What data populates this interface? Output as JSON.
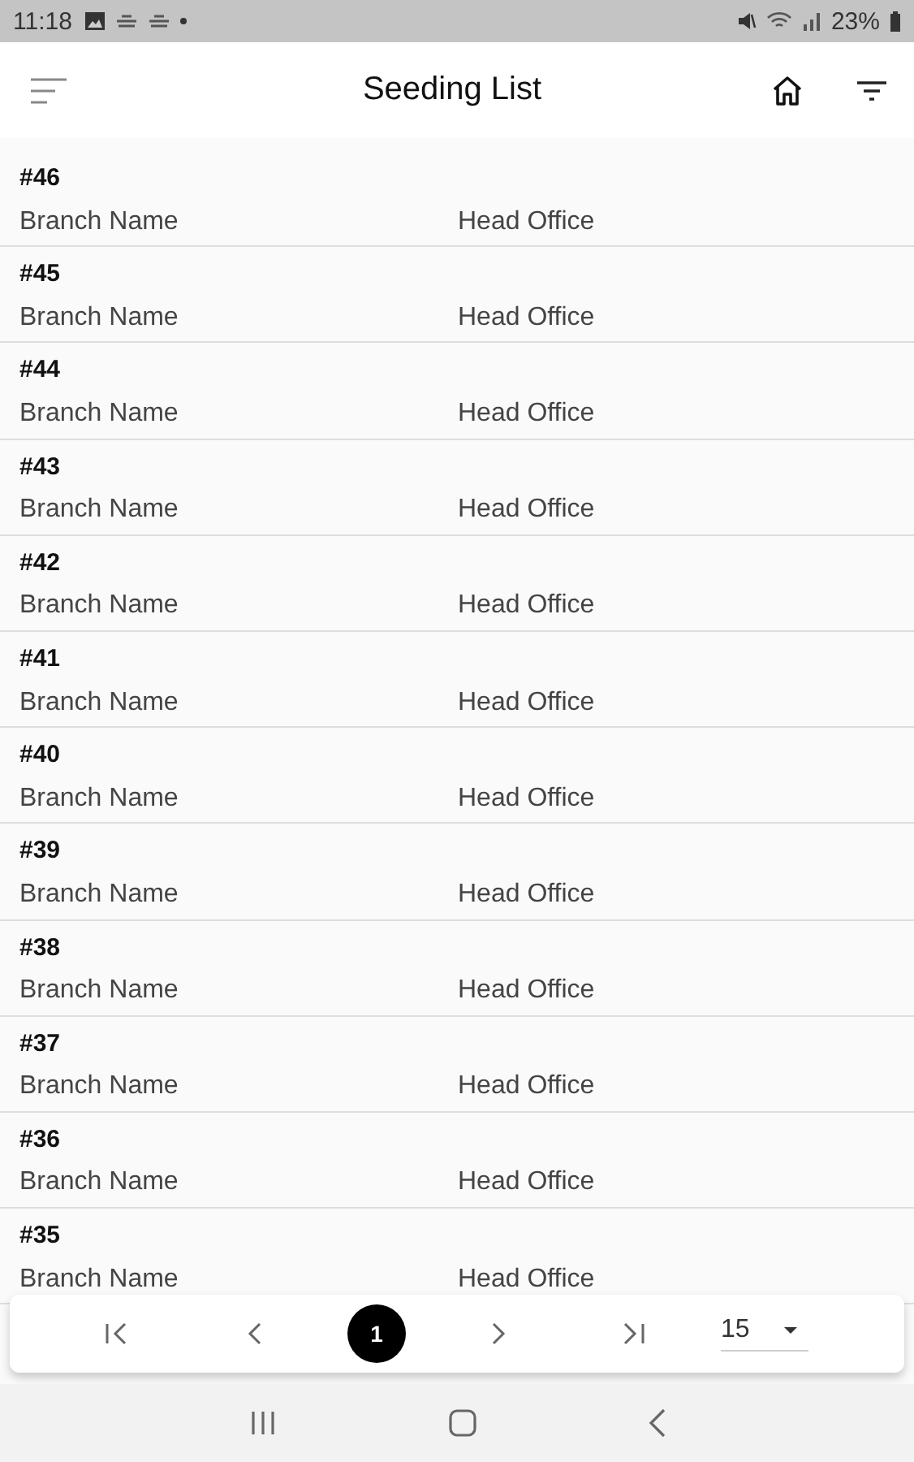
{
  "status_bar": {
    "time": "11:18",
    "battery": "23%"
  },
  "header": {
    "title": "Seeding List"
  },
  "rows": [
    {
      "number": "#46",
      "label": "Branch Name",
      "value": "Head Office"
    },
    {
      "number": "#45",
      "label": "Branch Name",
      "value": "Head Office"
    },
    {
      "number": "#44",
      "label": "Branch Name",
      "value": "Head Office"
    },
    {
      "number": "#43",
      "label": "Branch Name",
      "value": "Head Office"
    },
    {
      "number": "#42",
      "label": "Branch Name",
      "value": "Head Office"
    },
    {
      "number": "#41",
      "label": "Branch Name",
      "value": "Head Office"
    },
    {
      "number": "#40",
      "label": "Branch Name",
      "value": "Head Office"
    },
    {
      "number": "#39",
      "label": "Branch Name",
      "value": "Head Office"
    },
    {
      "number": "#38",
      "label": "Branch Name",
      "value": "Head Office"
    },
    {
      "number": "#37",
      "label": "Branch Name",
      "value": "Head Office"
    },
    {
      "number": "#36",
      "label": "Branch Name",
      "value": "Head Office"
    },
    {
      "number": "#35",
      "label": "Branch Name",
      "value": "Head Office"
    }
  ],
  "pagination": {
    "pages": [
      {
        "label": "1",
        "selected": true
      }
    ],
    "per_page": "15"
  }
}
